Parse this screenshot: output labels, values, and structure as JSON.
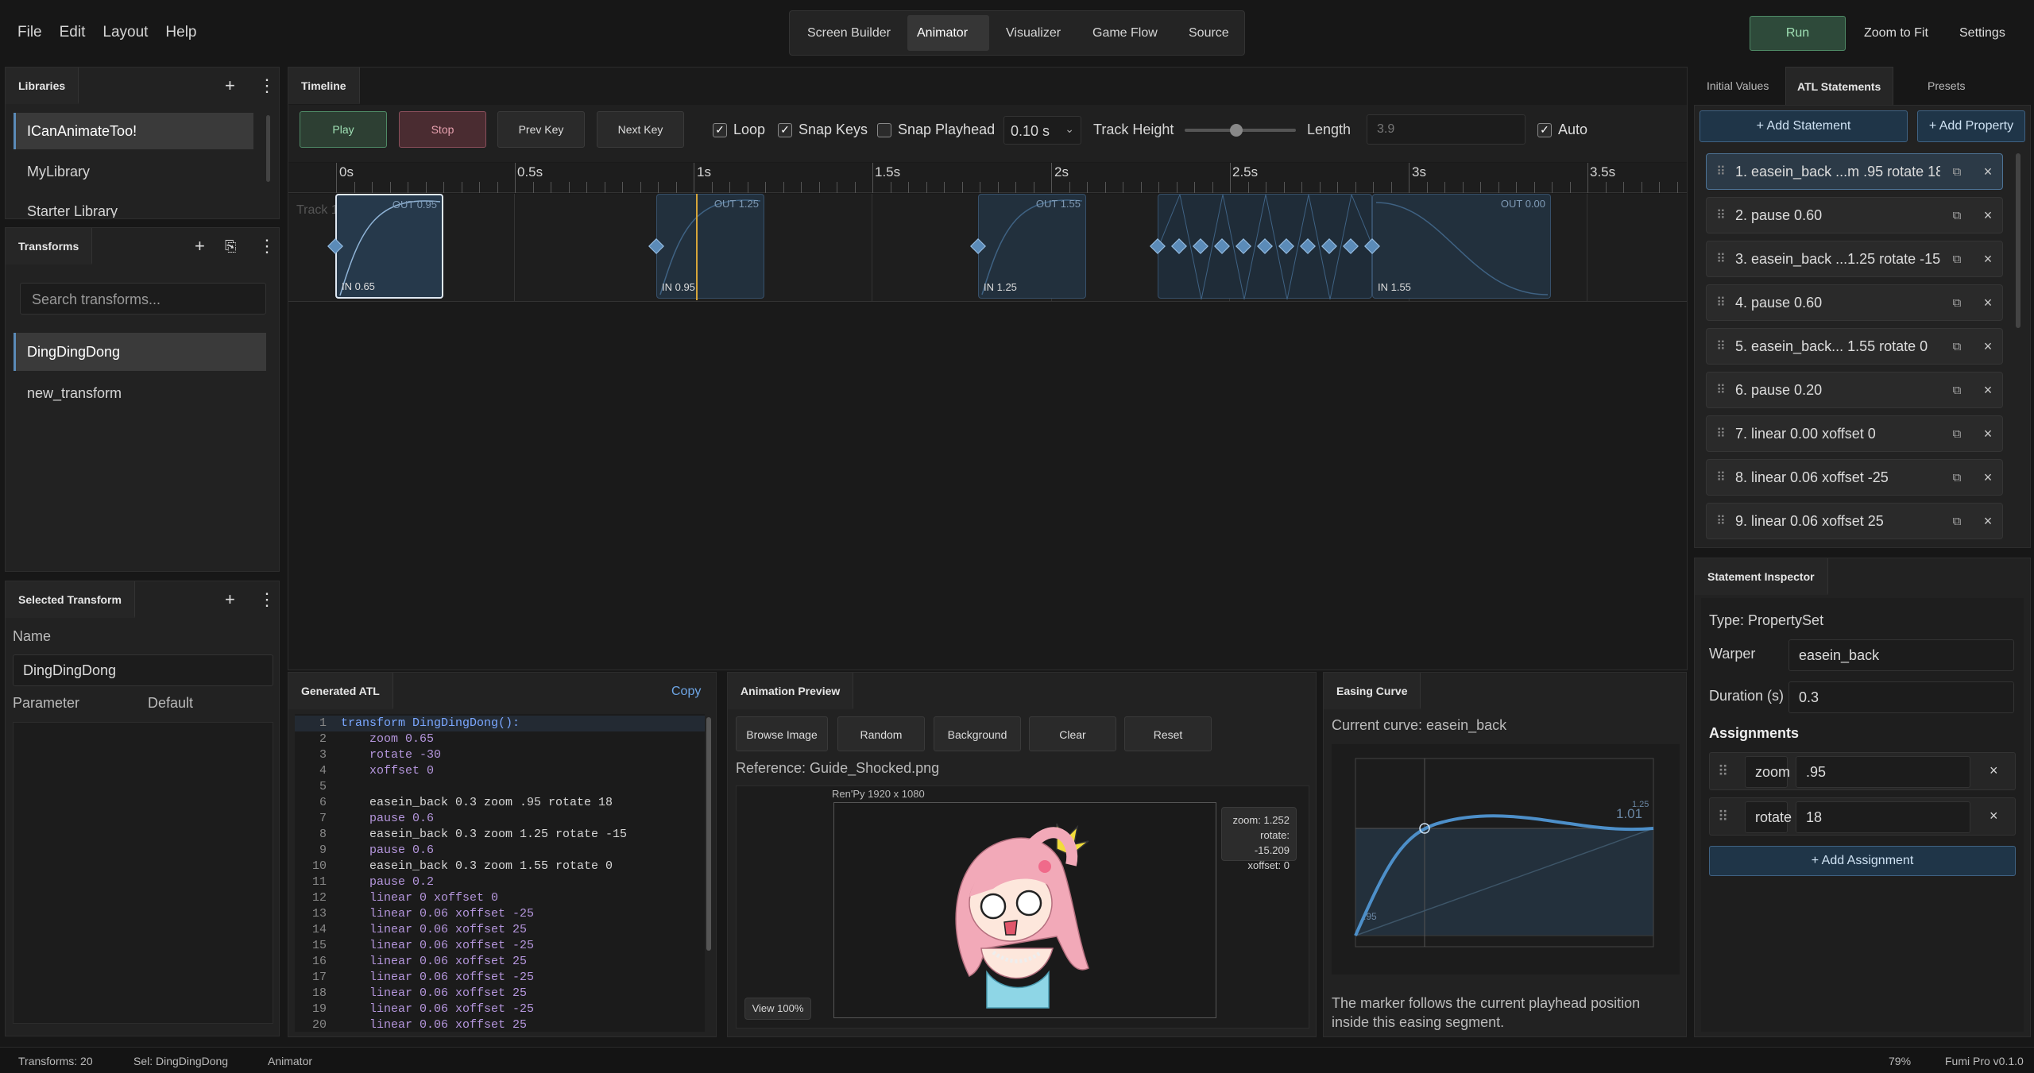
{
  "menu": [
    "File",
    "Edit",
    "Layout",
    "Help"
  ],
  "top_tabs": [
    "Screen Builder",
    "Animator",
    "Visualizer",
    "Game Flow",
    "Source"
  ],
  "top_right": {
    "run": "Run",
    "zoom": "Zoom to Fit",
    "settings": "Settings"
  },
  "libraries": {
    "title": "Libraries",
    "items": [
      "ICanAnimateToo!",
      "MyLibrary",
      "Starter Library"
    ]
  },
  "transforms": {
    "title": "Transforms",
    "search_placeholder": "Search transforms...",
    "items": [
      "DingDingDong",
      "new_transform"
    ]
  },
  "selected_transform": {
    "title": "Selected Transform",
    "name_label": "Name",
    "name_value": "DingDingDong",
    "param_label": "Parameter",
    "default_label": "Default"
  },
  "timeline": {
    "tab": "Timeline",
    "play": "Play",
    "stop": "Stop",
    "prev_key": "Prev Key",
    "next_key": "Next Key",
    "loop": "Loop",
    "snap_keys": "Snap Keys",
    "snap_playhead": "Snap Playhead",
    "snap_value": "0.10 s",
    "track_height": "Track Height",
    "length_label": "Length",
    "length_value": "3.9",
    "auto": "Auto",
    "track_label": "Track 1",
    "ruler": [
      "0s",
      "0.5s",
      "1s",
      "1.5s",
      "2s",
      "2.5s",
      "3s",
      "3.5s"
    ],
    "segments": [
      {
        "in": "IN 0.65",
        "out": "OUT 0.95"
      },
      {
        "in": "IN 0.95",
        "out": "OUT 1.25"
      },
      {
        "in": "IN 1.25",
        "out": "OUT 1.55"
      },
      {
        "in": "IN 1.55",
        "out": "OUT 0.00"
      }
    ]
  },
  "atl_tabs": [
    "Initial Values",
    "ATL Statements",
    "Presets"
  ],
  "atl": {
    "add_statement": "+ Add Statement",
    "add_property": "+ Add Property",
    "statements": [
      "1. easein_back ...m .95 rotate 18",
      "2. pause 0.60",
      "3. easein_back ...1.25 rotate -15",
      "4. pause 0.60",
      "5. easein_back... 1.55 rotate 0",
      "6. pause 0.20",
      "7. linear 0.00 xoffset 0",
      "8. linear 0.06 xoffset -25",
      "9. linear 0.06 xoffset 25"
    ]
  },
  "inspector": {
    "tab": "Statement Inspector",
    "type": "Type: PropertySet",
    "warper_label": "Warper",
    "warper_value": "easein_back",
    "duration_label": "Duration (s)",
    "duration_value": "0.3",
    "assignments_label": "Assignments",
    "assignments": [
      {
        "prop": "zoom",
        "value": ".95"
      },
      {
        "prop": "rotate",
        "value": "18"
      }
    ],
    "add_assignment": "+ Add Assignment"
  },
  "generated_atl": {
    "tab": "Generated ATL",
    "copy": "Copy",
    "lines": [
      {
        "n": "1",
        "t": "transform DingDingDong():"
      },
      {
        "n": "2",
        "t": "    zoom 0.65"
      },
      {
        "n": "3",
        "t": "    rotate -30"
      },
      {
        "n": "4",
        "t": "    xoffset 0"
      },
      {
        "n": "5",
        "t": ""
      },
      {
        "n": "6",
        "t": "    easein_back 0.3 zoom .95 rotate 18"
      },
      {
        "n": "7",
        "t": "    pause 0.6"
      },
      {
        "n": "8",
        "t": "    easein_back 0.3 zoom 1.25 rotate -15"
      },
      {
        "n": "9",
        "t": "    pause 0.6"
      },
      {
        "n": "10",
        "t": "    easein_back 0.3 zoom 1.55 rotate 0"
      },
      {
        "n": "11",
        "t": "    pause 0.2"
      },
      {
        "n": "12",
        "t": "    linear 0 xoffset 0"
      },
      {
        "n": "13",
        "t": "    linear 0.06 xoffset -25"
      },
      {
        "n": "14",
        "t": "    linear 0.06 xoffset 25"
      },
      {
        "n": "15",
        "t": "    linear 0.06 xoffset -25"
      },
      {
        "n": "16",
        "t": "    linear 0.06 xoffset 25"
      },
      {
        "n": "17",
        "t": "    linear 0.06 xoffset -25"
      },
      {
        "n": "18",
        "t": "    linear 0.06 xoffset 25"
      },
      {
        "n": "19",
        "t": "    linear 0.06 xoffset -25"
      },
      {
        "n": "20",
        "t": "    linear 0.06 xoffset 25"
      }
    ]
  },
  "preview": {
    "tab": "Animation Preview",
    "buttons": [
      "Browse Image",
      "Random",
      "Background",
      "Clear",
      "Reset"
    ],
    "reference": "Reference: Guide_Shocked.png",
    "canvas_label": "Ren'Py 1920 x 1080",
    "readout": [
      "zoom: 1.252",
      "rotate: -15.209",
      "xoffset: 0"
    ],
    "view": "View 100%"
  },
  "easing": {
    "tab": "Easing Curve",
    "current": "Current curve: easein_back",
    "label_top": "1.25",
    "label_marker": "1.01",
    "label_bottom": ".95",
    "note": "The marker follows the current playhead position inside this easing segment."
  },
  "status": {
    "transforms": "Transforms: 20",
    "sel": "Sel: DingDingDong",
    "mode": "Animator",
    "zoom": "79%",
    "version": "Fumi Pro v0.1.0"
  },
  "colors": {
    "run": "#2e4a3a",
    "play": "#2d3f33",
    "stop": "#4a2c31",
    "accent": "#5b8bb8"
  }
}
